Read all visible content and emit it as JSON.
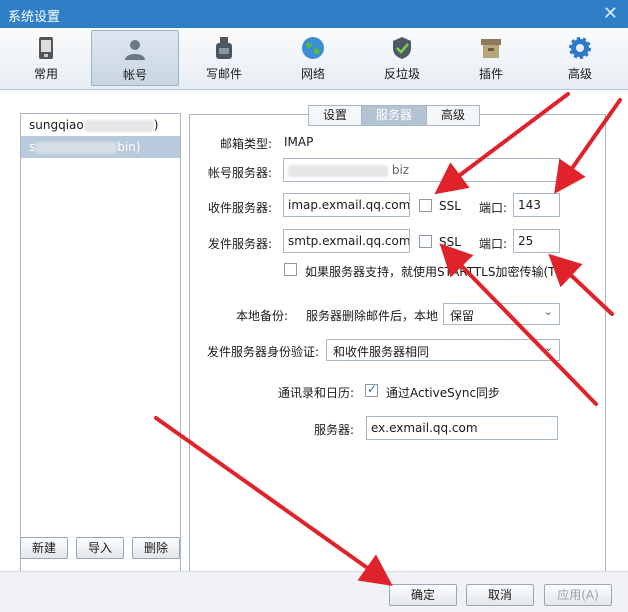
{
  "window": {
    "title": "系统设置",
    "close": "✕"
  },
  "toolbar": {
    "items": [
      {
        "label": "常用",
        "icon": "phone-icon"
      },
      {
        "label": "帐号",
        "icon": "user-icon",
        "active": true
      },
      {
        "label": "写邮件",
        "icon": "ink-bottle-icon"
      },
      {
        "label": "网络",
        "icon": "globe-icon"
      },
      {
        "label": "反垃圾",
        "icon": "shield-icon"
      },
      {
        "label": "插件",
        "icon": "box-icon"
      },
      {
        "label": "高级",
        "icon": "gear-icon"
      }
    ]
  },
  "accounts": [
    {
      "prefix": "sungqiao",
      "suffix": ")"
    },
    {
      "prefix": "s",
      "suffix": "bin)",
      "selected": true
    }
  ],
  "tabs": [
    "设置",
    "服务器",
    "高级"
  ],
  "form": {
    "mailbox_type_label": "邮箱类型:",
    "mailbox_type_value": "IMAP",
    "account_server_label": "帐号服务器:",
    "account_server_value": "biz",
    "incoming_label": "收件服务器:",
    "incoming_value": "imap.exmail.qq.com",
    "ssl_label": "SSL",
    "port_label": "端口:",
    "incoming_port": "143",
    "outgoing_label": "发件服务器:",
    "outgoing_value": "smtp.exmail.qq.com",
    "outgoing_port": "25",
    "starttls_label": "如果服务器支持，就使用STARTTLS加密传输(T)",
    "local_backup_label": "本地备份:",
    "local_backup_desc": "服务器删除邮件后，本地",
    "local_backup_value": "保留",
    "smtp_auth_label": "发件服务器身份验证:",
    "smtp_auth_value": "和收件服务器相同",
    "contacts_label": "通讯录和日历:",
    "activesync_label": "通过ActiveSync同步",
    "server_label": "服务器:",
    "server_value": "ex.exmail.qq.com"
  },
  "list_buttons": {
    "new": "新建",
    "import": "导入",
    "delete": "删除"
  },
  "footer": {
    "ok": "确定",
    "cancel": "取消",
    "apply": "应用(A)"
  },
  "colors": {
    "titlebar": "#2f7fc7",
    "arrow": "#e0232a",
    "selected": "#b8c9db"
  }
}
